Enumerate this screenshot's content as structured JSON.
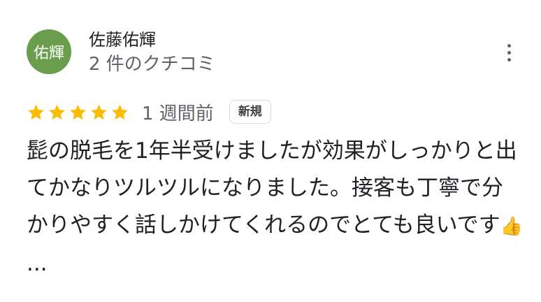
{
  "author": {
    "avatar_text": "佑輝",
    "avatar_color": "#6a9e4c",
    "name": "佐藤佑輝",
    "review_count": "2 件のクチコミ"
  },
  "more_icon": "more-vert-icon",
  "rating": {
    "stars": 5,
    "max_stars": 5,
    "star_color": "#fbbc04",
    "date": "1 週間前",
    "badge": "新規"
  },
  "review": {
    "text": "髭の脱毛を1年半受けましたが効果がしっかりと出てかなりツルツルになりました。接客も丁寧で分かりやすく話しかけてくれるのでとても良いです",
    "emoji": "👍",
    "ellipsis": " ..."
  }
}
